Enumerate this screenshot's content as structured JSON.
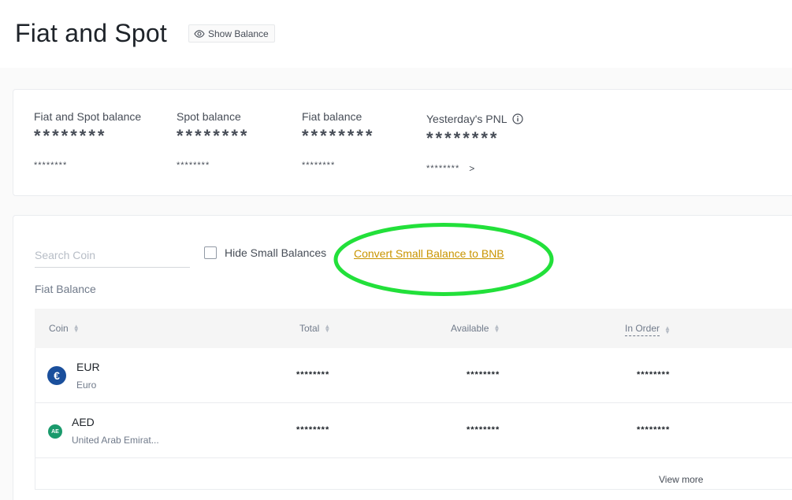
{
  "header": {
    "title": "Fiat and Spot",
    "show_balance_label": "Show Balance"
  },
  "balances": [
    {
      "label": "Fiat and Spot balance",
      "value": "********",
      "sub": "********"
    },
    {
      "label": "Spot balance",
      "value": "********",
      "sub": "********"
    },
    {
      "label": "Fiat balance",
      "value": "********",
      "sub": "********"
    },
    {
      "label": "Yesterday's PNL",
      "value": "********",
      "sub": "********",
      "chevron": ">"
    }
  ],
  "controls": {
    "search_placeholder": "Search Coin",
    "hide_small_label": "Hide Small Balances",
    "hide_small_checked": false,
    "convert_link": "Convert Small Balance to BNB",
    "highlight_color": "#22e03a"
  },
  "section_label": "Fiat Balance",
  "table": {
    "headers": {
      "coin": "Coin",
      "total": "Total",
      "available": "Available",
      "in_order": "In Order"
    },
    "rows": [
      {
        "symbol": "EUR",
        "name": "Euro",
        "icon_glyph": "€",
        "icon_color": "#1a4f9c",
        "total": "********",
        "available": "********",
        "in_order": "********"
      },
      {
        "symbol": "AED",
        "name": "United Arab Emirat...",
        "icon_glyph": "AE",
        "icon_color": "#1a9a6c",
        "total": "********",
        "available": "********",
        "in_order": "********"
      }
    ],
    "view_more": "View more"
  },
  "colors": {
    "accent": "#c99400",
    "text": "#1e2329",
    "muted": "#707a8a"
  }
}
